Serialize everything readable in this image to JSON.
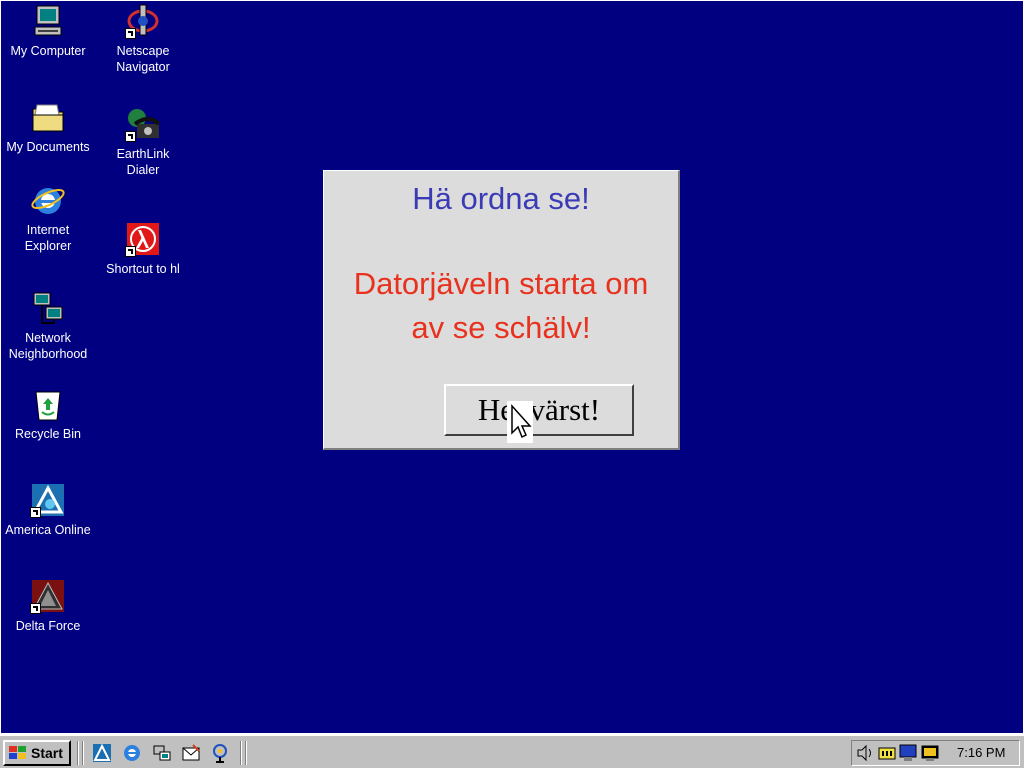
{
  "desktop": {
    "background_color": "#000080",
    "icons": [
      {
        "label": "My Computer",
        "icon": "computer-icon"
      },
      {
        "label": "Netscape\nNavigator",
        "icon": "netscape-icon"
      },
      {
        "label": "My Documents",
        "icon": "folder-icon"
      },
      {
        "label": "EarthLink\nDialer",
        "icon": "phone-icon"
      },
      {
        "label": "Internet\nExplorer",
        "icon": "ie-icon"
      },
      {
        "label": "Shortcut to hl",
        "icon": "halflife-icon"
      },
      {
        "label": "Network\nNeighborhood",
        "icon": "network-icon"
      },
      {
        "label": "Recycle Bin",
        "icon": "recycle-bin-icon"
      },
      {
        "label": "America Online",
        "icon": "aol-icon"
      },
      {
        "label": "Delta Force",
        "icon": "delta-force-icon"
      }
    ]
  },
  "dialog": {
    "title": "Hä ordna se!",
    "message": "Datorjäveln starta om\nav se schälv!",
    "button_label": "He  värst!",
    "title_color": "#3b3bb5",
    "message_color": "#e8321e"
  },
  "taskbar": {
    "start_label": "Start",
    "quick_launch": [
      "aol-icon",
      "ie-icon",
      "desktop-icon",
      "outlook-icon",
      "channels-icon"
    ],
    "tray_icons": [
      "volume-icon",
      "monitor-icon",
      "display-icon",
      "screen-icon"
    ],
    "clock": "7:16 PM"
  }
}
